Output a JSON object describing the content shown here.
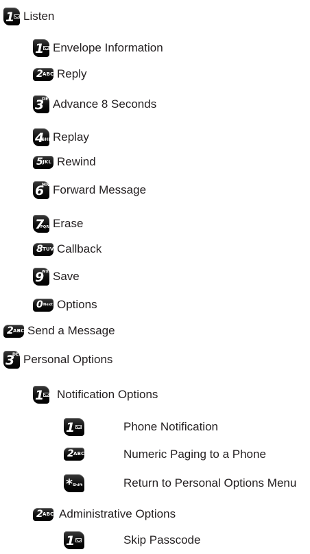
{
  "items": [
    {
      "key": "1",
      "sub": "",
      "label": "Listen"
    },
    {
      "key": "1",
      "sub": "",
      "label": "Envelope Information"
    },
    {
      "key": "2",
      "sub": "ABC",
      "label": "Reply"
    },
    {
      "key": "3",
      "sub": "DEF",
      "label": "Advance 8 Seconds"
    },
    {
      "key": "4",
      "sub": "GHI",
      "label": "Replay"
    },
    {
      "key": "5",
      "sub": "JKL",
      "label": "Rewind"
    },
    {
      "key": "6",
      "sub": "MNO",
      "label": "Forward Message"
    },
    {
      "key": "7",
      "sub": "PQRS",
      "label": "Erase"
    },
    {
      "key": "8",
      "sub": "TUV",
      "label": "Callback"
    },
    {
      "key": "9",
      "sub": "WXYZ",
      "label": "Save"
    },
    {
      "key": "0",
      "sub": "Next +",
      "label": "Options"
    },
    {
      "key": "2",
      "sub": "ABC",
      "label": "Send a Message"
    },
    {
      "key": "3",
      "sub": "DEF",
      "label": "Personal Options"
    },
    {
      "key": "1",
      "sub": "",
      "label": "Notification Options"
    },
    {
      "key": "1",
      "sub": "",
      "label": "Phone Notification"
    },
    {
      "key": "2",
      "sub": "ABC",
      "label": "Numeric Paging to a Phone"
    },
    {
      "key": "*",
      "sub": "Shift",
      "label": "Return to Personal Options Menu"
    },
    {
      "key": "2",
      "sub": "ABC",
      "label": "Administrative Options"
    },
    {
      "key": "1",
      "sub": "",
      "label": "Skip Passcode"
    }
  ]
}
